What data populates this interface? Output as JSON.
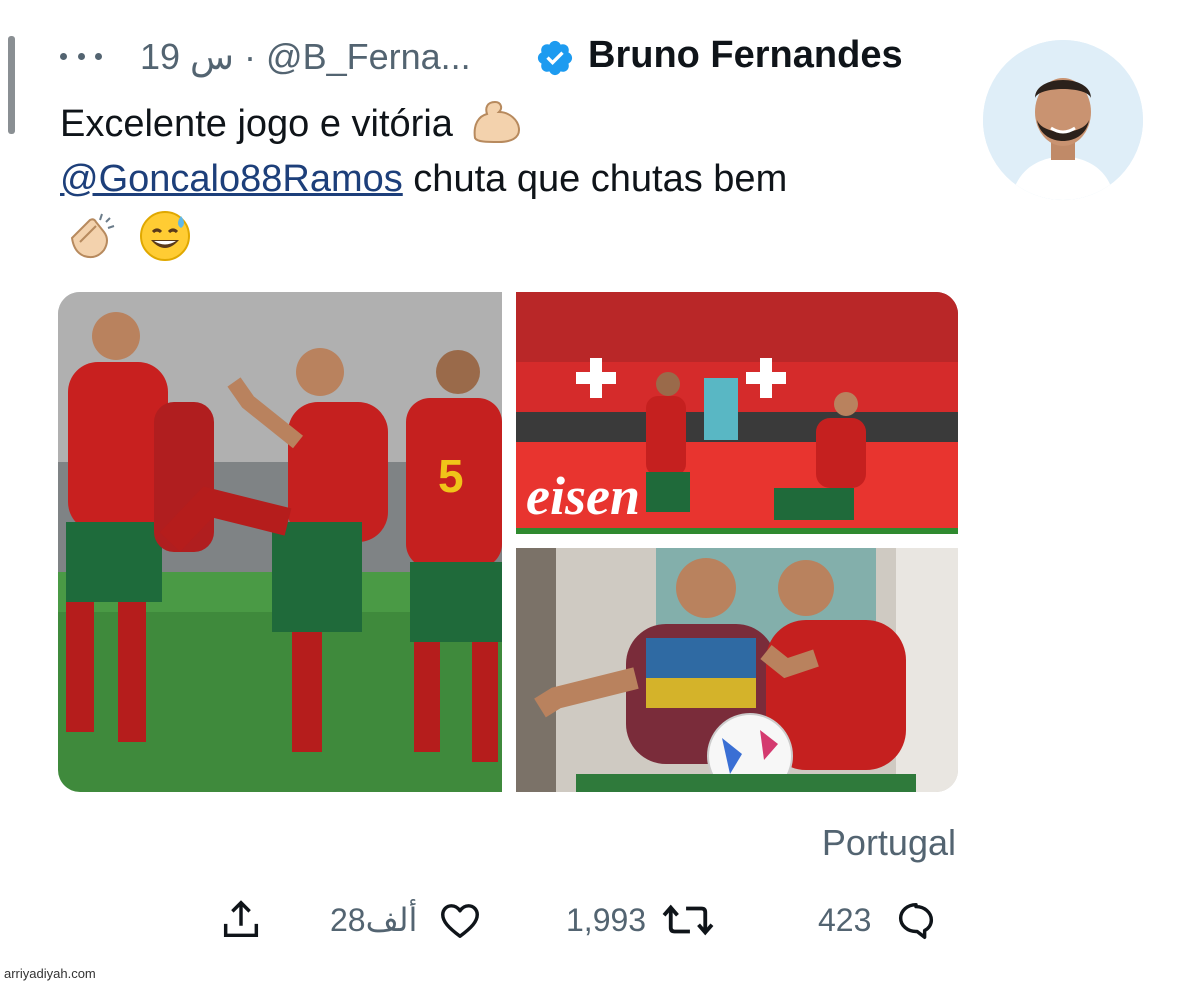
{
  "tweet": {
    "author_name": "Bruno Fernandes",
    "handle": "@B_Ferna...",
    "time": "19 س",
    "separator": "·",
    "text_line1": "Excelente jogo e vitória",
    "mention": "@Goncalo88Ramos",
    "text_line2_rest": " chuta que chutas bem",
    "location": "Portugal"
  },
  "actions": {
    "replies": "423",
    "retweets": "1,993",
    "likes": "28ألف"
  },
  "icons": {
    "more": "more-icon",
    "verified": "verified-badge-icon",
    "flex": "flexed-biceps-emoji",
    "clap": "clapping-hands-emoji",
    "grin": "grinning-sweat-emoji",
    "reply": "reply-icon",
    "retweet": "retweet-icon",
    "like": "like-icon",
    "share": "share-icon"
  },
  "colors": {
    "verified": "#1d9bf0",
    "mention": "#1d3f7a",
    "secondary": "#536471",
    "text": "#0f1419"
  },
  "watermark": "arriyadiyah.com"
}
